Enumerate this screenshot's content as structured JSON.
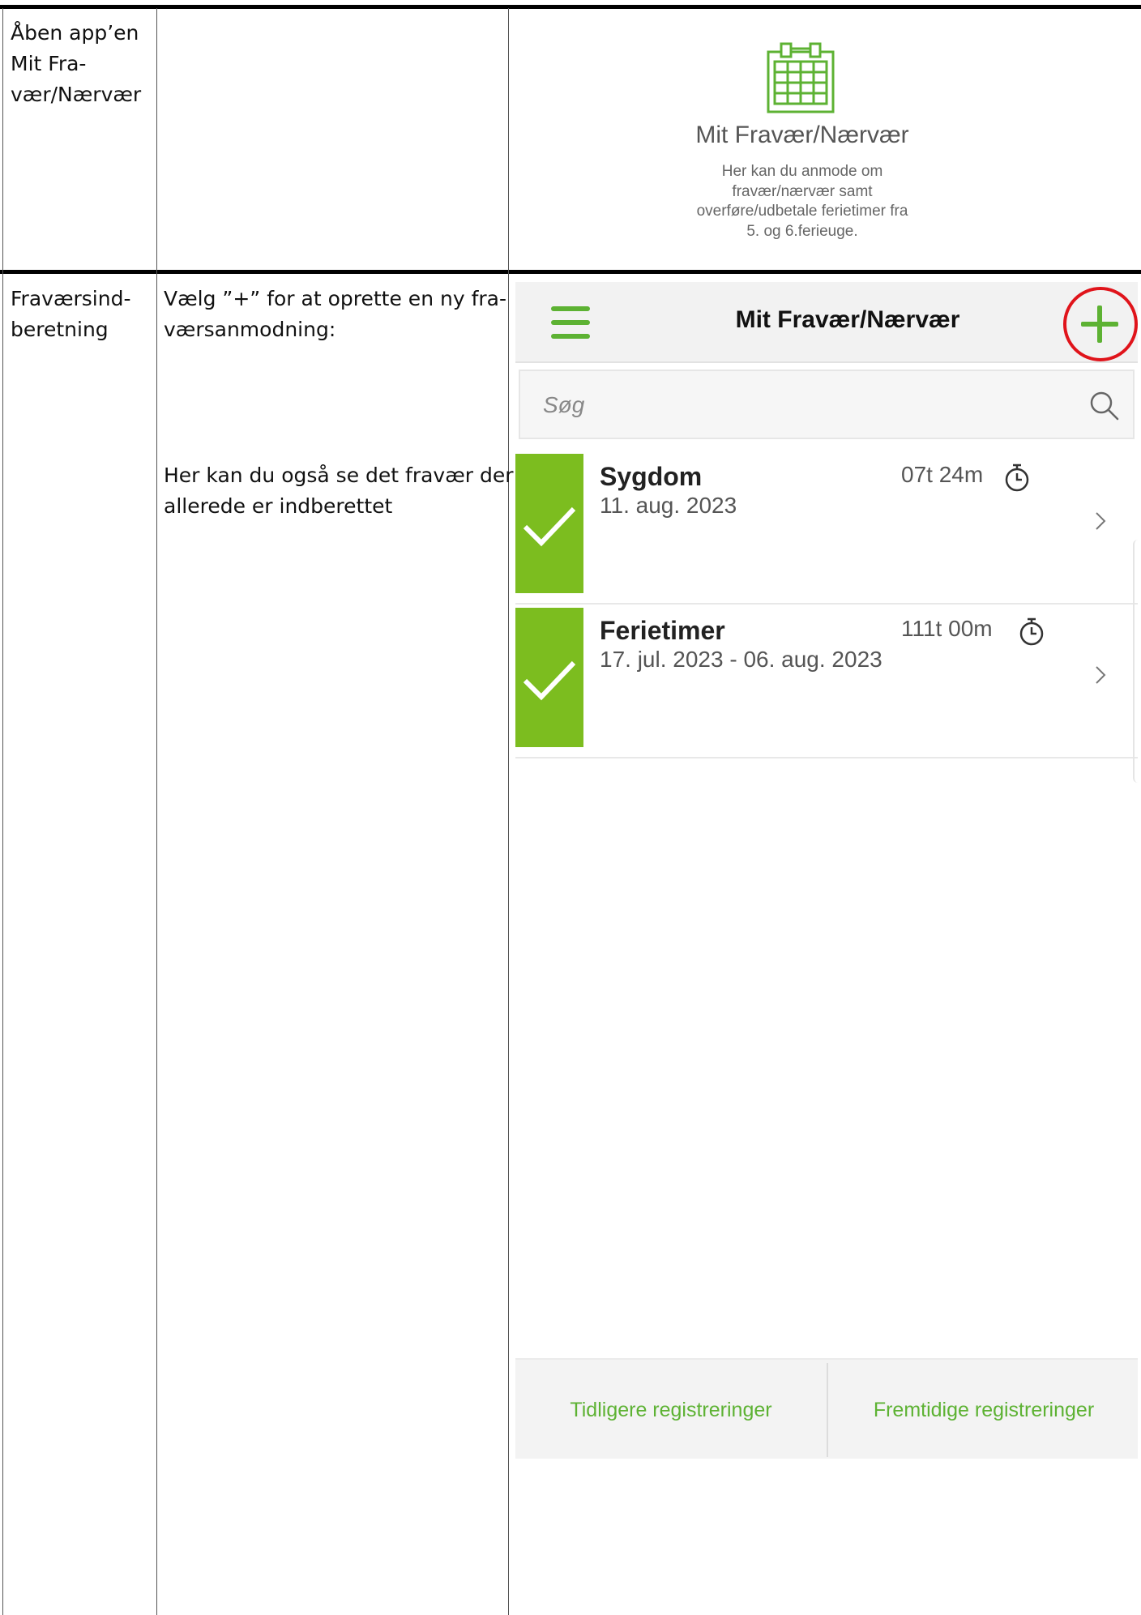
{
  "rows": [
    {
      "step_label": "Åben app’en Mit Fra-vær/Nærvær",
      "step_lines": [
        "Åben app’en",
        "Mit Fra-",
        "vær/Nærvær"
      ],
      "instruction_lines": []
    },
    {
      "step_lines": [
        "Fraværsind-",
        "beretning"
      ],
      "instruction_lines": [
        "Vælg ”+” for at oprette en ny fra-",
        "værsanmodning:"
      ],
      "note_lines": [
        "Her kan du også se det fravær der",
        "allerede er indberettet"
      ]
    }
  ],
  "app_tile": {
    "title": "Mit Fravær/Nærvær",
    "description_lines": [
      "Her kan du anmode om",
      "fravær/nærvær samt",
      "overføre/udbetale ferietimer fra",
      "5. og 6.ferieuge."
    ],
    "icon": "calendar-icon"
  },
  "phone": {
    "header_title": "Mit Fravær/Nærvær",
    "search_placeholder": "Søg",
    "items": [
      {
        "title": "Sygdom",
        "date": "11. aug. 2023",
        "duration": "07t 24m",
        "status": "approved"
      },
      {
        "title": "Ferietimer",
        "date": "17. jul. 2023 - 06. aug. 2023",
        "duration": "111t 00m",
        "status": "approved"
      }
    ],
    "bottom_tabs": [
      "Tidligere registreringer",
      "Fremtidige registreringer"
    ]
  },
  "colors": {
    "accent_green": "#5db233",
    "status_green": "#7cbd1f",
    "highlight_red": "#e0141b"
  }
}
